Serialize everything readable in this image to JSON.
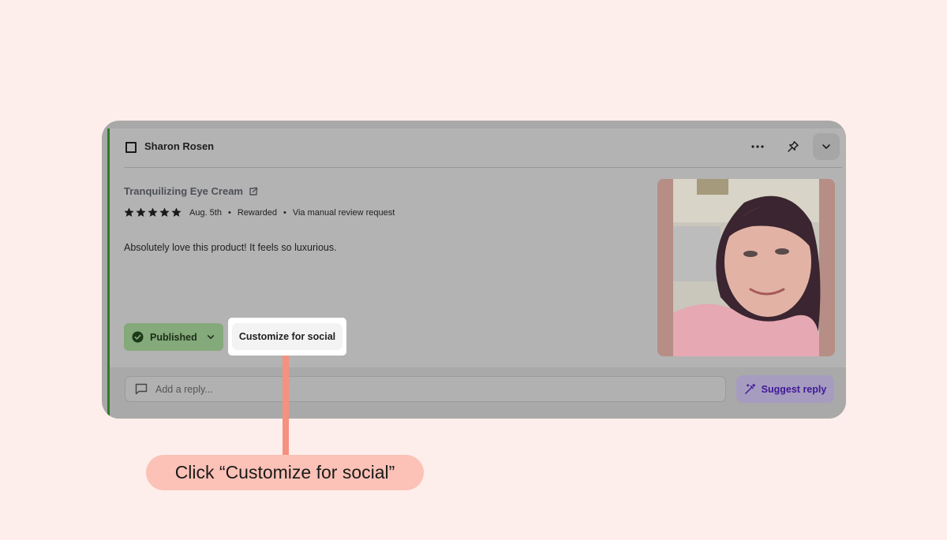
{
  "review": {
    "reviewer_name": "Sharon Rosen",
    "product_name": "Tranquilizing Eye Cream",
    "rating": 5,
    "rating_max": 5,
    "date": "Aug. 5th",
    "reward_status": "Rewarded",
    "source": "Via manual review request",
    "separator": "•",
    "body": "Absolutely love this product! It feels so luxurious."
  },
  "actions": {
    "status_label": "Published",
    "customize_label": "Customize for social",
    "reply_placeholder": "Add a reply...",
    "suggest_label": "Suggest reply"
  },
  "callout": {
    "text": "Click “Customize for social”"
  },
  "colors": {
    "published_accent": "#2f7b25",
    "suggest_text": "#3f1a96",
    "callout_bg": "#fcc2b7",
    "connector": "#f6907f"
  }
}
